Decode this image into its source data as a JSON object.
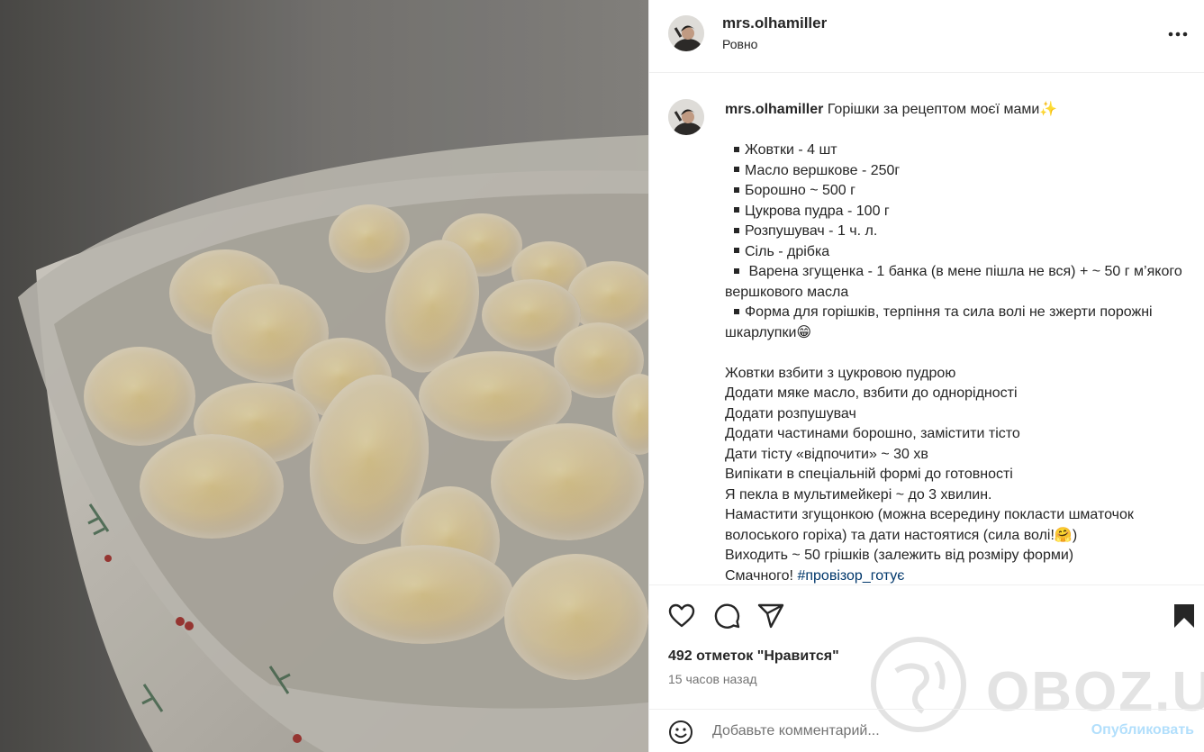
{
  "post": {
    "username": "mrs.olhamiller",
    "location": "Ровно",
    "caption_title": "Горішки за рецептом моєї мами✨",
    "ingredients": [
      "Жовтки - 4 шт",
      "Масло вершкове - 250г",
      "Борошно ~ 500 г",
      "Цукрова пудра - 100 г",
      "Розпушувач - 1 ч. л.",
      "Сіль - дрібка",
      " Варена згущенка - 1 банка (в мене пішла не вся) + ~ 50 г м’якого вершкового масла",
      "Форма для горішків, терпіння та сила волі не зжерти порожні шкарлупки😁"
    ],
    "steps": [
      "Жовтки взбити з цукровою пудрою",
      "Додати мяке масло, взбити до однорідності",
      "Додати розпушувач",
      "Додати частинами борошно, замістити тісто",
      "Дати тісту «відпочити» ~ 30 хв",
      "Випікати в спеціальній формі до готовності",
      "Я пекла в мультимейкері ~ до 3 хвилин.",
      "Намастити згущонкою (можна всередину покласти шматочок волоського горіха) та дати настоятися (сила волі!🤗)",
      "Виходить ~ 50 грішків (залежить від розміру форми)"
    ],
    "closing": "Смачного! ",
    "hashtag": "#провізор_готує",
    "likes": "492 отметок \"Нравится\"",
    "time_ago": "15 часов назад"
  },
  "comment": {
    "placeholder": "Добавьте комментарий...",
    "publish_label": "Опубликовать"
  },
  "watermark": {
    "text": "OBOZ.UA"
  },
  "icons": {
    "more": "more-horizontal-icon",
    "like": "heart-icon",
    "comment": "comment-icon",
    "share": "send-icon",
    "save": "bookmark-icon",
    "emoji": "emoji-icon"
  },
  "colors": {
    "hashtag": "#00376b",
    "publish": "#b2dffc",
    "muted": "#737373"
  }
}
